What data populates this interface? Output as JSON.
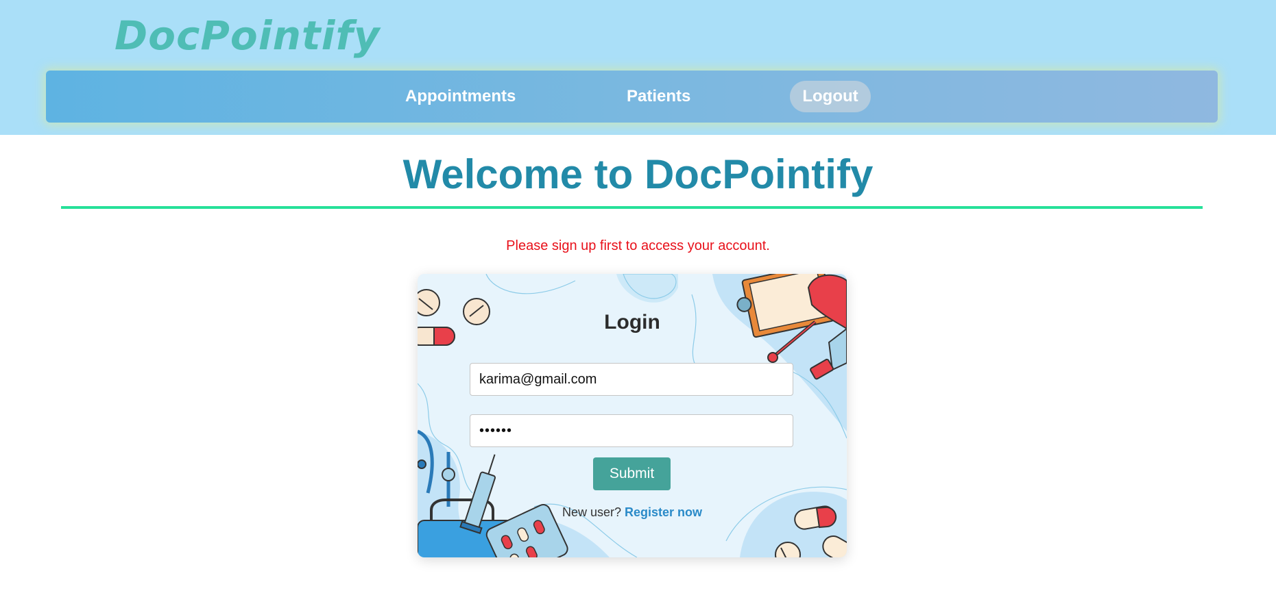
{
  "header": {
    "brand": "DocPointify"
  },
  "nav": {
    "items": [
      {
        "label": "Appointments"
      },
      {
        "label": "Patients"
      },
      {
        "label": "Logout"
      }
    ]
  },
  "main": {
    "title": "Welcome to DocPointify",
    "alert": "Please sign up first to access your account."
  },
  "login": {
    "title": "Login",
    "email_value": "karima@gmail.com",
    "password_value": "••••••",
    "submit_label": "Submit",
    "new_user_text": "New user?",
    "register_label": "Register now"
  },
  "colors": {
    "header_bg": "#aadff8",
    "brand": "#4fbdb5",
    "title": "#228aa8",
    "rule": "#26e099",
    "alert": "#e8101a",
    "submit": "#45a39a",
    "link": "#2a8ac8"
  },
  "icons": [
    "pill-icon",
    "clipboard-icon",
    "stethoscope-icon",
    "syringe-icon",
    "medical-bag-icon",
    "blister-pack-icon",
    "thermometer-icon"
  ]
}
